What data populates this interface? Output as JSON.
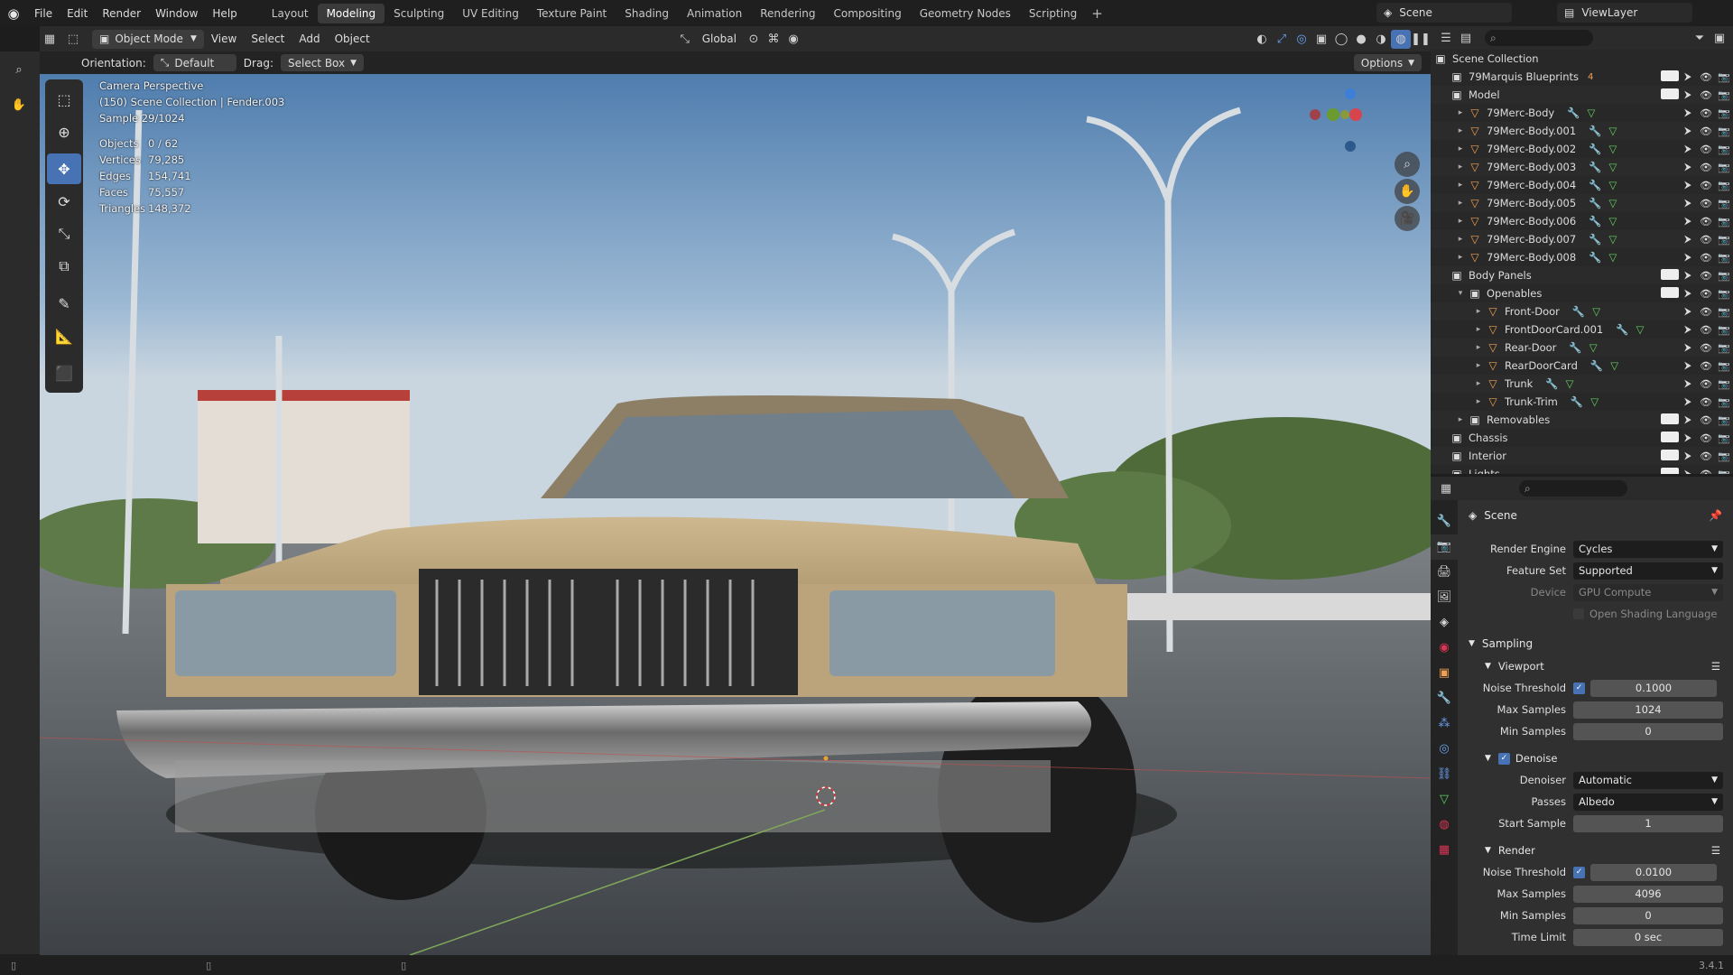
{
  "menu": [
    "File",
    "Edit",
    "Render",
    "Window",
    "Help"
  ],
  "workspaces": [
    "Layout",
    "Modeling",
    "Sculpting",
    "UV Editing",
    "Texture Paint",
    "Shading",
    "Animation",
    "Rendering",
    "Compositing",
    "Geometry Nodes",
    "Scripting"
  ],
  "active_workspace": "Modeling",
  "scene_name": "Scene",
  "view_layer": "ViewLayer",
  "viewport_header": {
    "mode": "Object Mode",
    "view": "View",
    "select": "Select",
    "add": "Add",
    "object": "Object",
    "transform": "Global"
  },
  "viewport_sub": {
    "orientation_label": "Orientation:",
    "orientation_value": "Default",
    "drag_label": "Drag:",
    "drag_value": "Select Box",
    "options": "Options"
  },
  "overlay": {
    "line1": "Camera Perspective",
    "line2": "(150) Scene Collection | Fender.003",
    "line3": "Sample 29/1024"
  },
  "stats": [
    {
      "k": "Objects",
      "v": "0 / 62"
    },
    {
      "k": "Vertices",
      "v": "79,285"
    },
    {
      "k": "Edges",
      "v": "154,741"
    },
    {
      "k": "Faces",
      "v": "75,557"
    },
    {
      "k": "Triangles",
      "v": "148,372"
    }
  ],
  "outliner": {
    "root": "Scene Collection",
    "rows": [
      {
        "indent": 0,
        "tri": "",
        "icon": "collection-icon",
        "label": "79Marquis Blueprints",
        "count": "4",
        "check": true
      },
      {
        "indent": 0,
        "tri": "",
        "icon": "collection-icon",
        "label": "Model",
        "check": true
      },
      {
        "indent": 1,
        "tri": "▸",
        "icon": "mesh-icon",
        "label": "79Merc-Body"
      },
      {
        "indent": 1,
        "tri": "▸",
        "icon": "mesh-icon",
        "label": "79Merc-Body.001"
      },
      {
        "indent": 1,
        "tri": "▸",
        "icon": "mesh-icon",
        "label": "79Merc-Body.002"
      },
      {
        "indent": 1,
        "tri": "▸",
        "icon": "mesh-icon",
        "label": "79Merc-Body.003"
      },
      {
        "indent": 1,
        "tri": "▸",
        "icon": "mesh-icon",
        "label": "79Merc-Body.004"
      },
      {
        "indent": 1,
        "tri": "▸",
        "icon": "mesh-icon",
        "label": "79Merc-Body.005"
      },
      {
        "indent": 1,
        "tri": "▸",
        "icon": "mesh-icon",
        "label": "79Merc-Body.006"
      },
      {
        "indent": 1,
        "tri": "▸",
        "icon": "mesh-icon",
        "label": "79Merc-Body.007"
      },
      {
        "indent": 1,
        "tri": "▸",
        "icon": "mesh-icon",
        "label": "79Merc-Body.008"
      },
      {
        "indent": 0,
        "tri": "",
        "icon": "collection-icon",
        "label": "Body Panels",
        "check": true
      },
      {
        "indent": 1,
        "tri": "▾",
        "icon": "collection-icon",
        "label": "Openables",
        "check": true
      },
      {
        "indent": 2,
        "tri": "▸",
        "icon": "mesh-icon",
        "label": "Front-Door"
      },
      {
        "indent": 2,
        "tri": "▸",
        "icon": "mesh-icon",
        "label": "FrontDoorCard.001"
      },
      {
        "indent": 2,
        "tri": "▸",
        "icon": "mesh-icon",
        "label": "Rear-Door"
      },
      {
        "indent": 2,
        "tri": "▸",
        "icon": "mesh-icon",
        "label": "RearDoorCard"
      },
      {
        "indent": 2,
        "tri": "▸",
        "icon": "mesh-icon",
        "label": "Trunk"
      },
      {
        "indent": 2,
        "tri": "▸",
        "icon": "mesh-icon",
        "label": "Trunk-Trim"
      },
      {
        "indent": 1,
        "tri": "▸",
        "icon": "collection-icon",
        "label": "Removables",
        "check": true
      },
      {
        "indent": 0,
        "tri": "",
        "icon": "collection-icon",
        "label": "Chassis",
        "check": true
      },
      {
        "indent": 0,
        "tri": "",
        "icon": "collection-icon",
        "label": "Interior",
        "check": true
      },
      {
        "indent": 0,
        "tri": "",
        "icon": "collection-icon",
        "label": "Lights",
        "check": true
      }
    ]
  },
  "props": {
    "context": "Scene",
    "render_engine": {
      "label": "Render Engine",
      "value": "Cycles"
    },
    "feature_set": {
      "label": "Feature Set",
      "value": "Supported"
    },
    "device": {
      "label": "Device",
      "value": "GPU Compute"
    },
    "osl": "Open Shading Language",
    "sampling": "Sampling",
    "viewport": "Viewport",
    "vp_noise": {
      "label": "Noise Threshold",
      "value": "0.1000"
    },
    "vp_max": {
      "label": "Max Samples",
      "value": "1024"
    },
    "vp_min": {
      "label": "Min Samples",
      "value": "0"
    },
    "denoise": "Denoise",
    "denoiser": {
      "label": "Denoiser",
      "value": "Automatic"
    },
    "passes": {
      "label": "Passes",
      "value": "Albedo"
    },
    "start_sample": {
      "label": "Start Sample",
      "value": "1"
    },
    "render": "Render",
    "r_noise": {
      "label": "Noise Threshold",
      "value": "0.0100"
    },
    "r_max": {
      "label": "Max Samples",
      "value": "4096"
    },
    "r_min": {
      "label": "Min Samples",
      "value": "0"
    },
    "time_limit": {
      "label": "Time Limit",
      "value": "0 sec"
    }
  },
  "version": "3.4.1"
}
